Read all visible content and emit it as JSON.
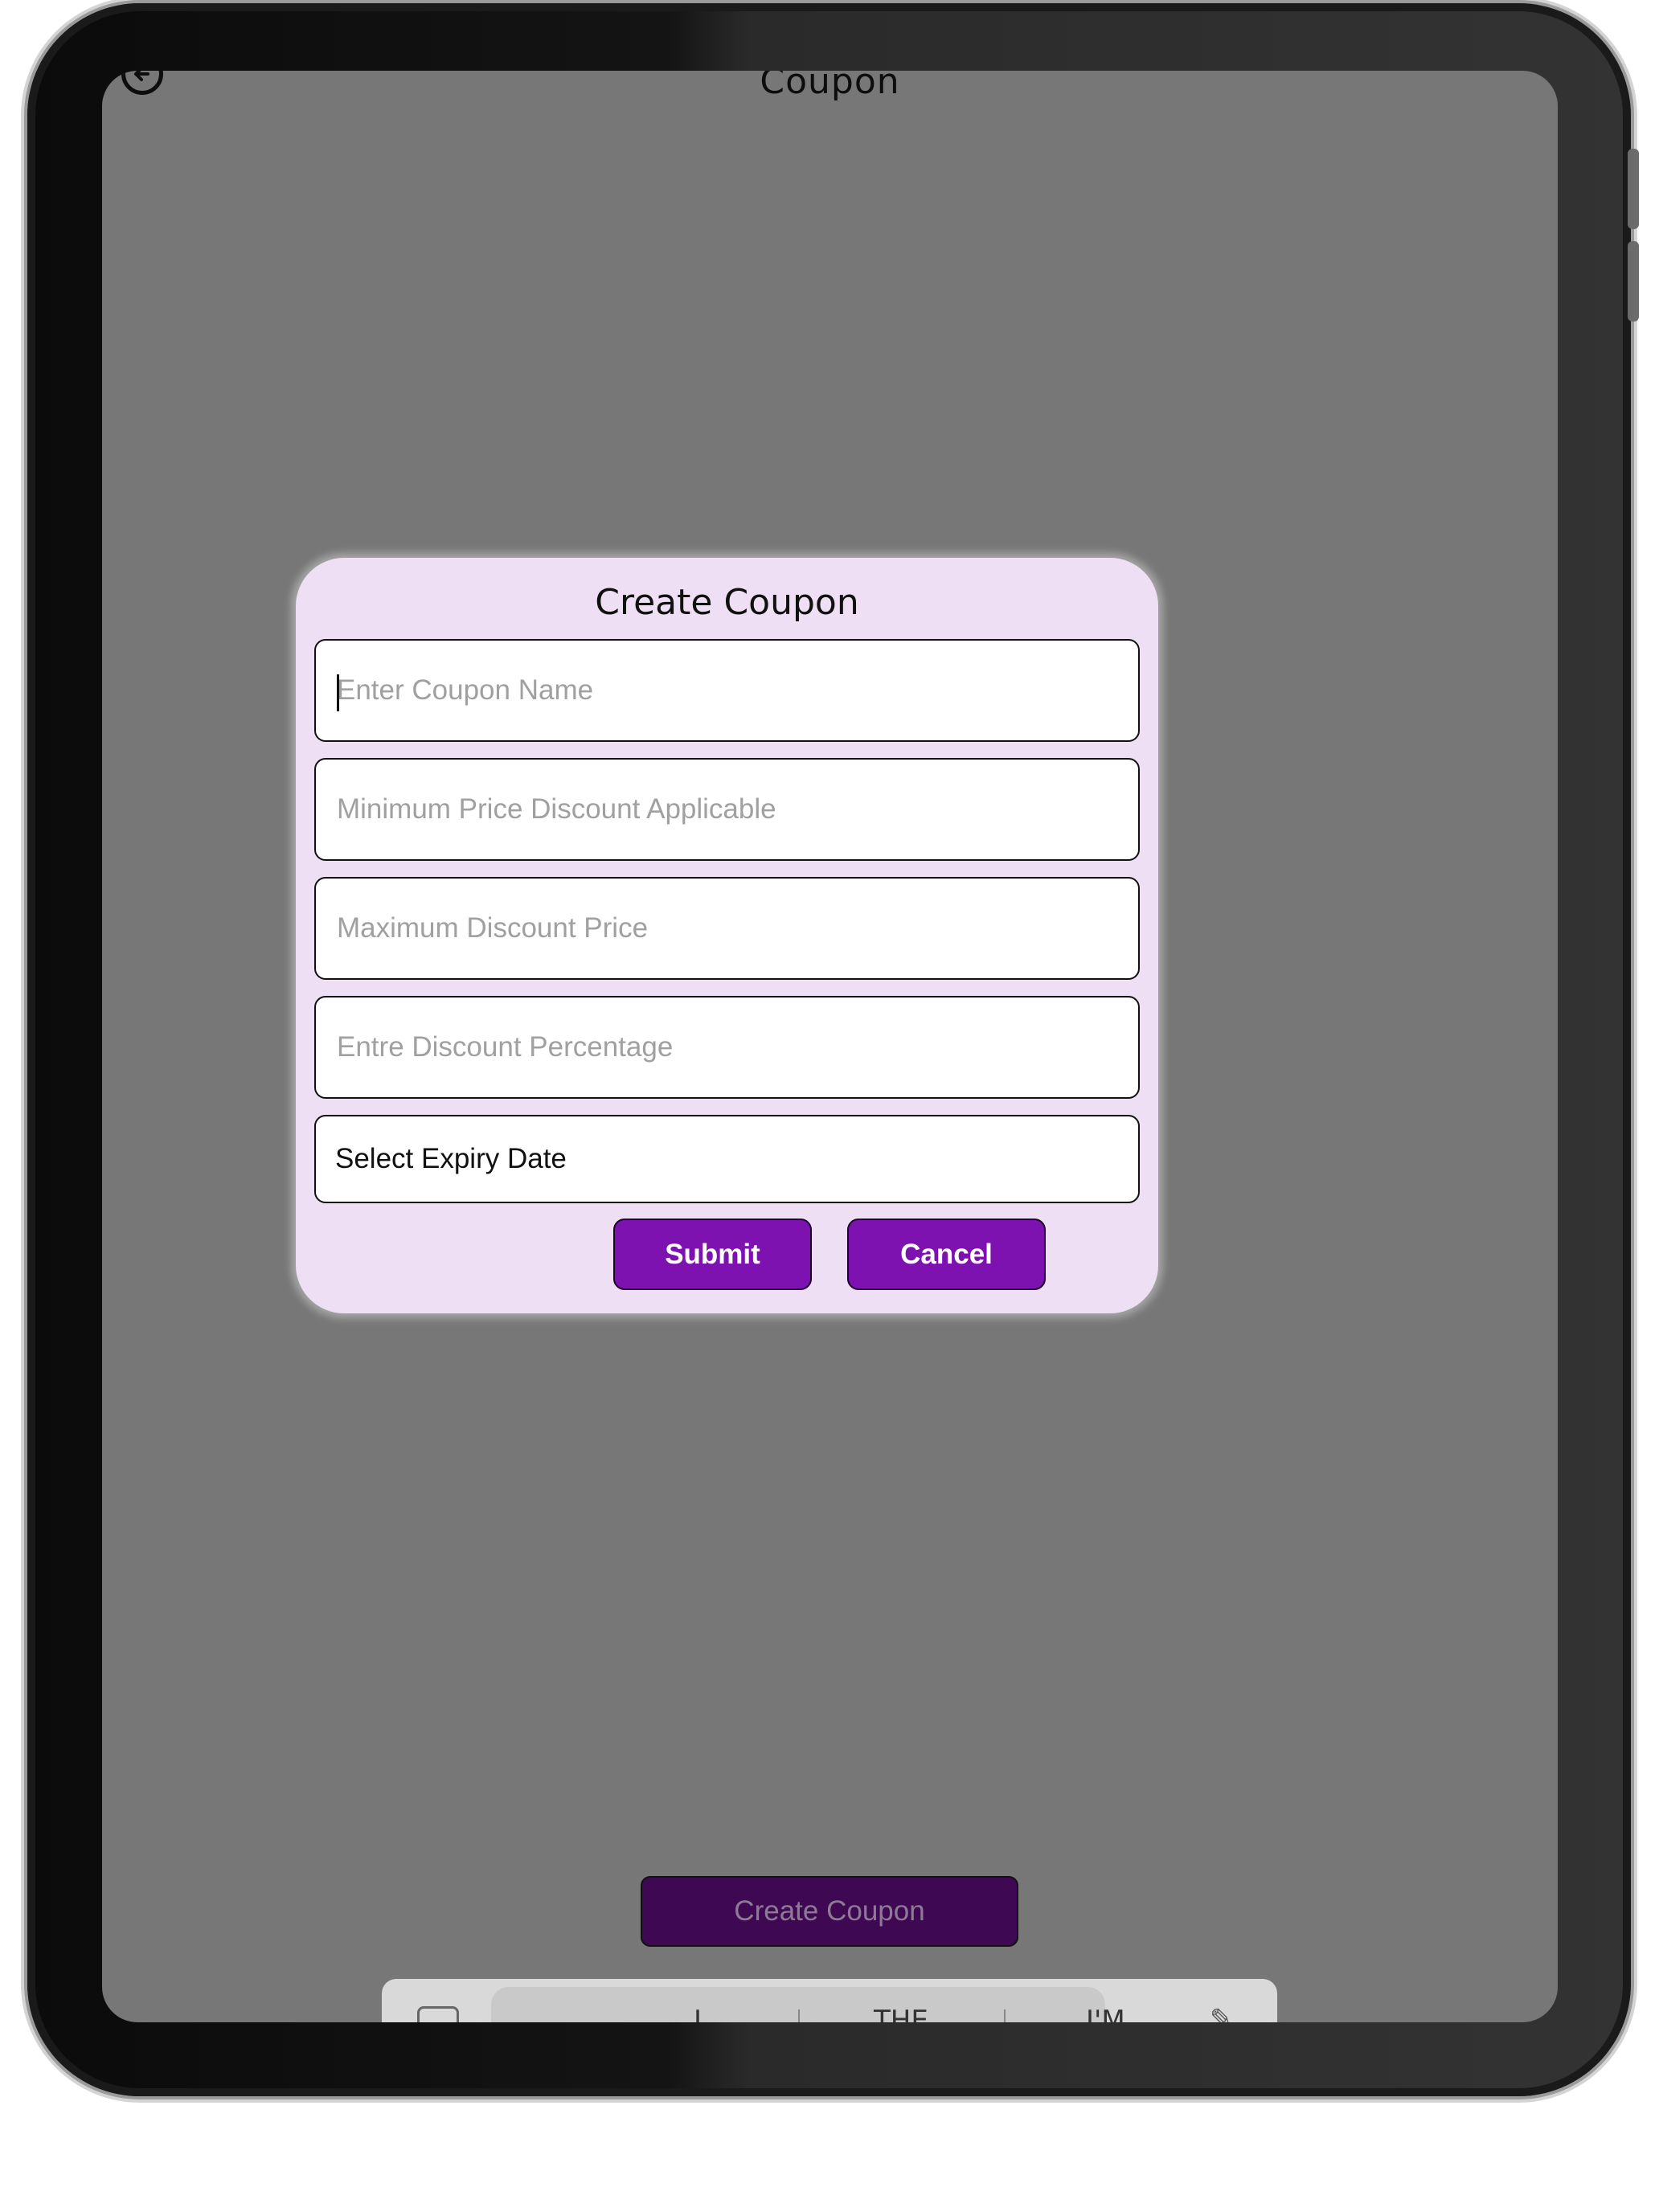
{
  "header": {
    "title": "Coupon",
    "back_icon": "back-arrow-circle-icon"
  },
  "dialog": {
    "title": "Create Coupon",
    "fields": {
      "coupon_name": {
        "placeholder": "Enter Coupon Name",
        "value": ""
      },
      "min_price": {
        "placeholder": "Minimum Price Discount Applicable",
        "value": ""
      },
      "max_discount": {
        "placeholder": "Maximum Discount Price",
        "value": ""
      },
      "discount_percentage": {
        "placeholder": "Entre Discount Percentage",
        "value": ""
      },
      "expiry_date": {
        "label": "Select Expiry Date"
      }
    },
    "submit_label": "Submit",
    "cancel_label": "Cancel"
  },
  "background": {
    "create_coupon_label": "Create Coupon"
  },
  "keyboard": {
    "suggestions": [
      "I",
      "THE",
      "I'M"
    ],
    "left_icon": "keyboard-icon",
    "right_icons": [
      "handwriting-icon",
      "microphone-icon"
    ]
  },
  "colors": {
    "accent": "#7e12b0",
    "dialog_bg": "#efdff5",
    "overlay": "#777777"
  }
}
